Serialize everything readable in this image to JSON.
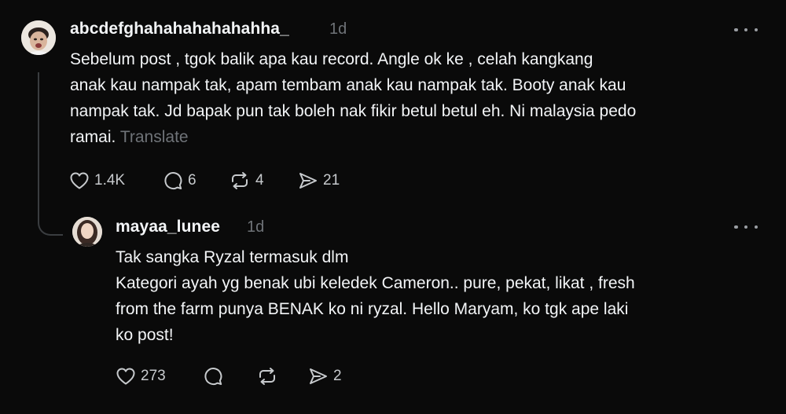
{
  "comment": {
    "username": "abcdefghahahahahahahha_",
    "time": "1d",
    "lines": [
      "Sebelum post , tgok balik apa kau record. Angle ok ke , celah kangkang",
      "anak kau nampak tak, apam tembam anak kau nampak tak. Booty anak kau",
      "nampak tak. Jd bapak pun tak boleh nak fikir betul betul eh. Ni malaysia pedo",
      "ramai."
    ],
    "translate_label": "Translate",
    "likes": "1.4K",
    "replies": "6",
    "reposts": "4",
    "shares": "21"
  },
  "reply": {
    "username": "mayaa_lunee",
    "time": "1d",
    "lines": [
      "Tak sangka Ryzal termasuk dlm",
      "Kategori ayah yg benak ubi keledek Cameron.. pure, pekat, likat , fresh",
      "from the farm punya BENAK ko ni ryzal. Hello Maryam, ko tgk ape laki",
      "ko post!"
    ],
    "likes": "273",
    "shares": "2"
  },
  "icons": {
    "like": "heart-icon",
    "reply": "comment-icon",
    "repost": "repost-icon",
    "share": "send-icon",
    "more": "more-options-icon"
  },
  "colors": {
    "background": "#0a0a0a",
    "primary_text": "#f3f5f7",
    "secondary_text": "#6f7378",
    "thread_line": "#3a3d40"
  }
}
